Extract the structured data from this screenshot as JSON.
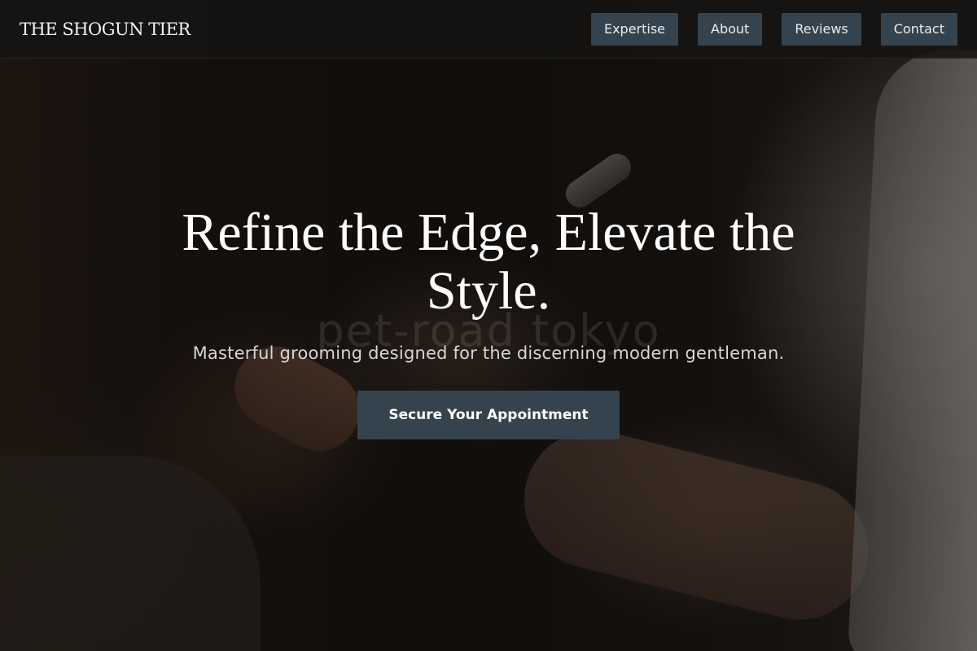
{
  "header": {
    "brand": "THE SHOGUN TIER",
    "nav": [
      {
        "label": "Expertise"
      },
      {
        "label": "About"
      },
      {
        "label": "Reviews"
      },
      {
        "label": "Contact"
      }
    ]
  },
  "hero": {
    "title": "Refine the Edge, Elevate the Style.",
    "watermark": "pet-road tokyo",
    "subtitle": "Masterful grooming designed for the discerning modern gentleman.",
    "cta_label": "Secure Your Appointment"
  },
  "colors": {
    "nav_button_bg": "#35434e",
    "header_bg": "#161413",
    "text_primary": "#ffffff"
  }
}
